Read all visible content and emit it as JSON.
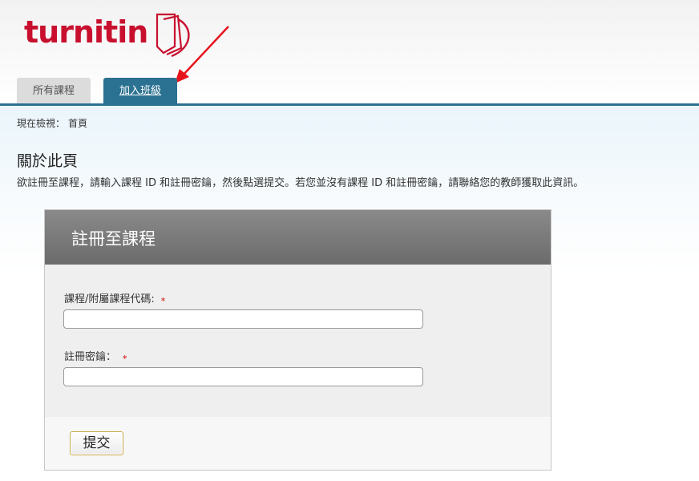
{
  "header": {
    "logo_text": "turnitin",
    "tabs": [
      {
        "label": "所有課程"
      },
      {
        "label": "加入班級"
      }
    ]
  },
  "breadcrumb": {
    "prefix": "現在檢視：",
    "link": "首頁"
  },
  "about": {
    "title": "關於此頁",
    "description": "欲註冊至課程，請輸入課程 ID 和註冊密鑰，然後點選提交。若您並沒有課程 ID 和註冊密鑰，請聯絡您的教師獲取此資訊。"
  },
  "form": {
    "title": "註冊至課程",
    "fields": [
      {
        "label": "課程/附屬課程代碼:",
        "required_mark": "*",
        "value": ""
      },
      {
        "label": "註冊密鑰：",
        "required_mark": "*",
        "value": ""
      }
    ],
    "submit_label": "提交"
  },
  "colors": {
    "brand_red": "#c8102e",
    "tab_active": "#2b7191",
    "panel_header": "#7a7a7a",
    "required": "#cc0000"
  }
}
